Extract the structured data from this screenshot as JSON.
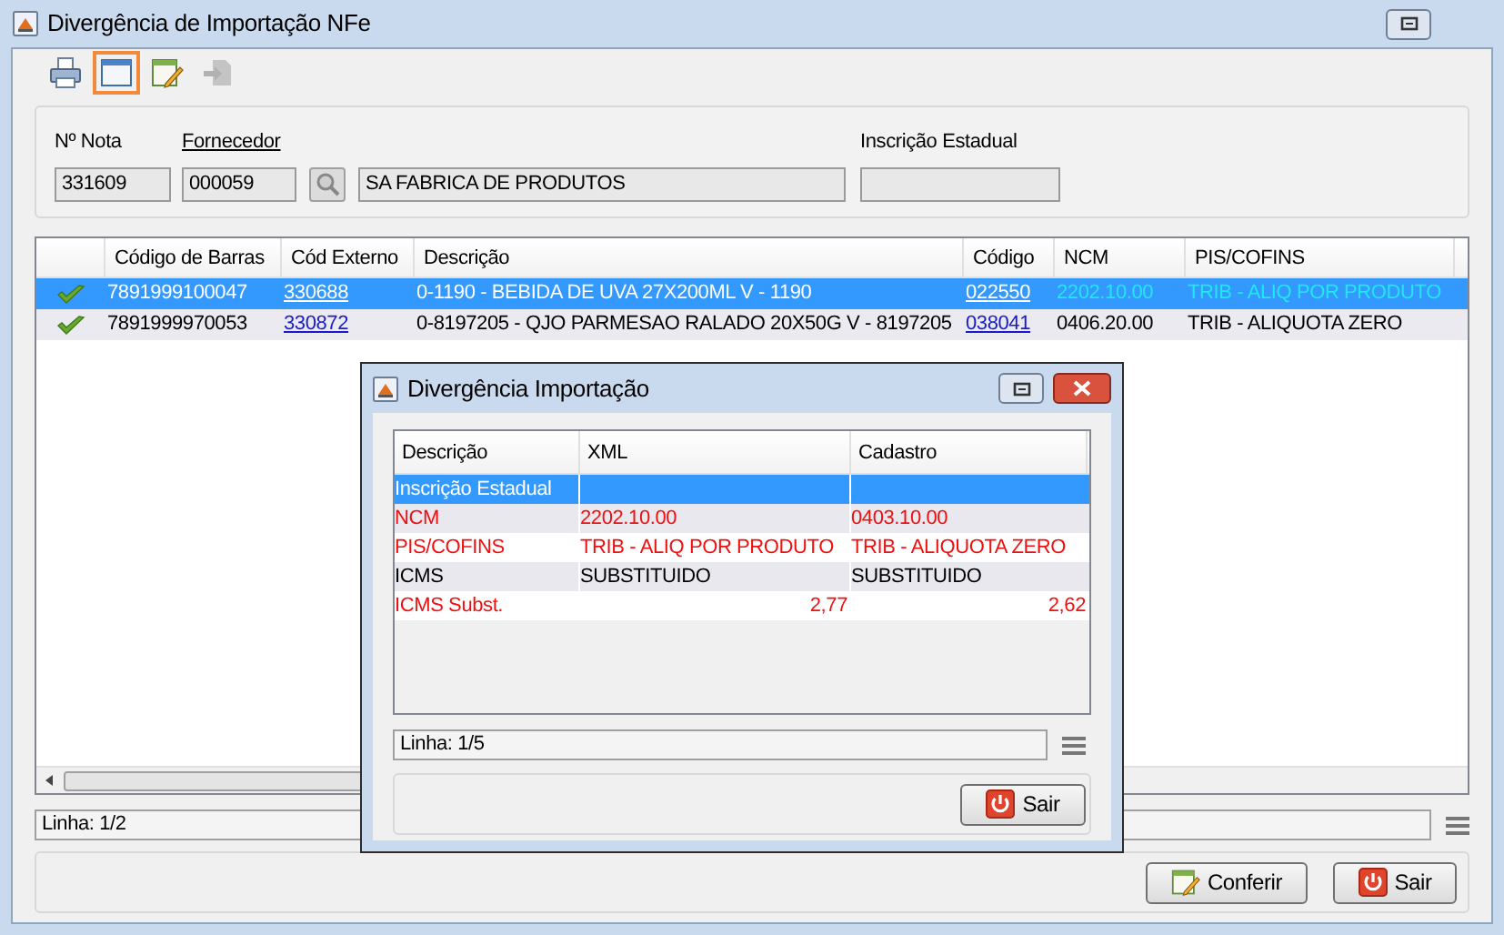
{
  "window": {
    "title": "Divergência de Importação NFe"
  },
  "toolbar": [
    {
      "kind": "print",
      "selected": false,
      "disabled": false
    },
    {
      "kind": "window",
      "selected": true,
      "disabled": false
    },
    {
      "kind": "edit",
      "selected": false,
      "disabled": false
    },
    {
      "kind": "exit",
      "selected": false,
      "disabled": true
    }
  ],
  "header": {
    "note_label": "Nº Nota",
    "note_value": "331609",
    "supplier_label": "Fornecedor",
    "supplier_code": "000059",
    "supplier_name": "SA FABRICA DE PRODUTOS",
    "state_reg_label": "Inscrição Estadual"
  },
  "table": {
    "columns": [
      "Código de Barras",
      "Cód Externo",
      "Descrição",
      "Código",
      "NCM",
      "PIS/COFINS"
    ],
    "rows": [
      {
        "selected": true,
        "checked": true,
        "barcode": "7891999100047",
        "external_code": "330688",
        "description": "0-1190 - BEBIDA DE UVA 27X200ML V - 1190",
        "code": "022550",
        "ncm": "2202.10.00",
        "ncm_divergent": true,
        "pis_cofins": "TRIB - ALIQ POR PRODUTO",
        "pis_divergent": true
      },
      {
        "selected": false,
        "checked": true,
        "barcode": "7891999970053",
        "external_code": "330872",
        "description": "0-8197205 - QJO PARMESAO RALADO 20X50G V - 8197205",
        "code": "038041",
        "ncm": "0406.20.00",
        "ncm_divergent": false,
        "pis_cofins": "TRIB - ALIQUOTA ZERO",
        "pis_divergent": false
      }
    ]
  },
  "status_bar": "Linha: 1/2",
  "buttons": [
    {
      "kind": "confirm",
      "label": "Conferir"
    },
    {
      "kind": "exit",
      "label": "Sair"
    }
  ],
  "dialog": {
    "title": "Divergência Importação",
    "columns": [
      "Descrição",
      "XML",
      "Cadastro"
    ],
    "rows": [
      {
        "selected": true,
        "divergent": false,
        "kind": "text",
        "cells": [
          "Inscrição Estadual"
        ]
      },
      {
        "selected": false,
        "divergent": true,
        "kind": "text",
        "cells": [
          "NCM",
          "2202.10.00",
          "0403.10.00"
        ]
      },
      {
        "selected": false,
        "divergent": true,
        "kind": "text",
        "cells": [
          "PIS/COFINS",
          "TRIB - ALIQ POR PRODUTO",
          "TRIB - ALIQUOTA ZERO"
        ]
      },
      {
        "selected": false,
        "divergent": false,
        "kind": "text",
        "cells": [
          "ICMS",
          "SUBSTITUIDO",
          "SUBSTITUIDO"
        ]
      },
      {
        "selected": false,
        "divergent": true,
        "kind": "number",
        "cells": [
          "ICMS Subst.",
          "2,77",
          "2,62"
        ]
      }
    ],
    "status_bar": "Linha: 1/5",
    "button": {
      "kind": "exit",
      "label": "Sair"
    }
  }
}
